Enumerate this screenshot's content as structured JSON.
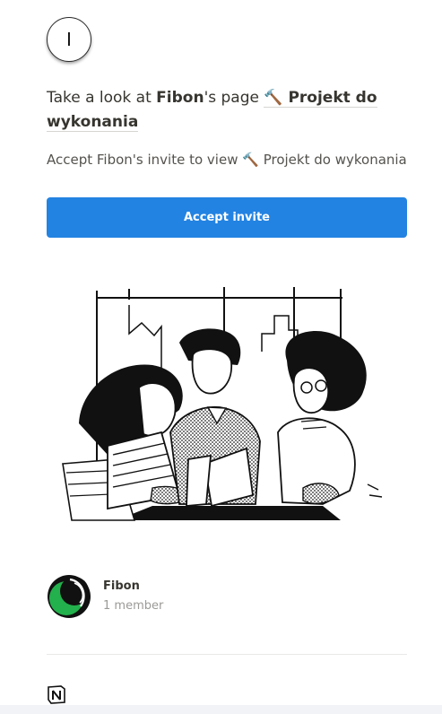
{
  "header": {
    "avatar_letter": "I"
  },
  "invite": {
    "title_prefix": "Take a look at ",
    "owner": "Fibon",
    "title_middle": "'s page ",
    "page_emoji": "🔨",
    "page_name": "Projekt do wykonania",
    "subtitle_prefix": "Accept Fibon's invite to view ",
    "subtitle_page": "Projekt do wykonania",
    "accept_label": "Accept invite"
  },
  "workspace": {
    "name": "Fibon",
    "members": "1 member",
    "icon": "green-crescent-icon"
  },
  "footer": {
    "logo": "notion-logo-icon"
  },
  "colors": {
    "accent": "#2383e2",
    "text": "#37352f",
    "muted": "#9b9a97",
    "workspace_green": "#22b14c"
  }
}
